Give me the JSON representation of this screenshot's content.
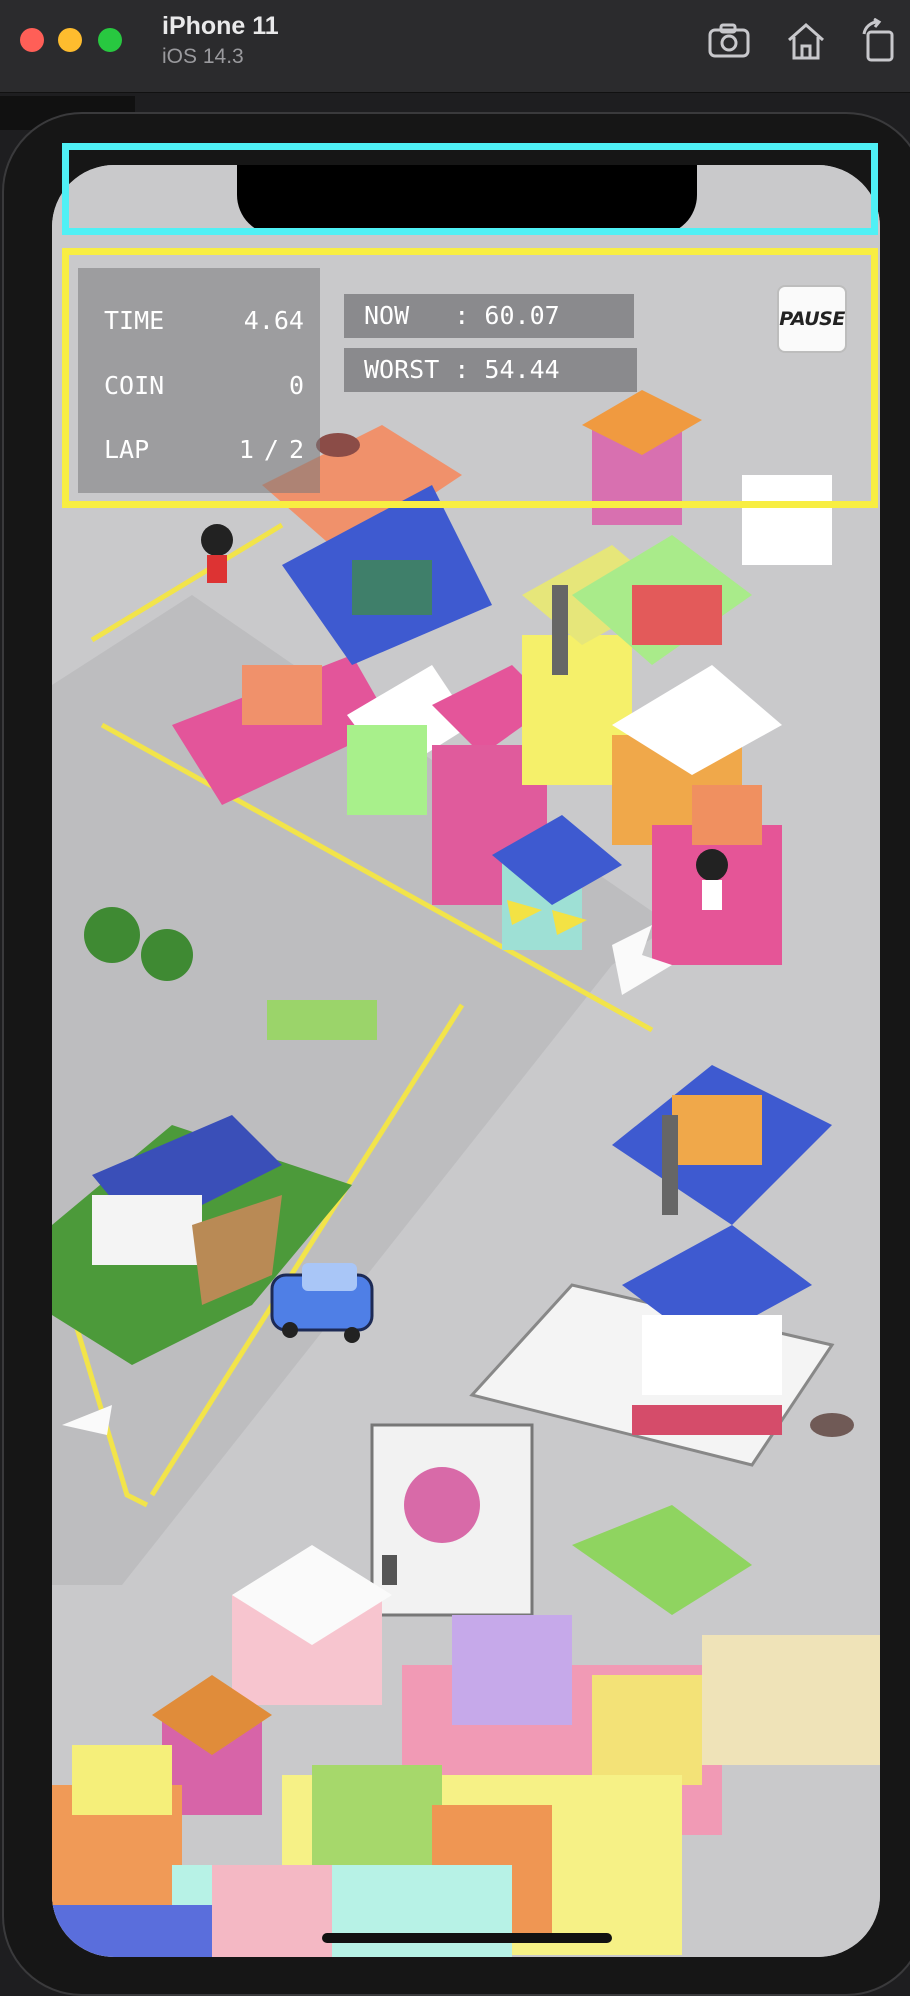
{
  "simulator": {
    "device_name": "iPhone 11",
    "os_version": "iOS 14.3",
    "toolbar_icons": [
      "screenshot-camera-icon",
      "home-icon",
      "rotate-icon"
    ]
  },
  "hud": {
    "time_label": "TIME",
    "time_value": "4.64",
    "coin_label": "COIN",
    "coin_value": "0",
    "lap_label": "LAP",
    "lap_current": "1",
    "lap_separator": "/",
    "lap_total": "2"
  },
  "records": {
    "now_text": "NOW   : 60.07",
    "worst_text": "WORST : 54.44"
  },
  "pause_label": "PAUSE",
  "colors": {
    "highlight_top": "#4ff0f5",
    "highlight_hud": "#f8ee42",
    "road": "#c9c9cb",
    "car": "#4f7fe6"
  }
}
